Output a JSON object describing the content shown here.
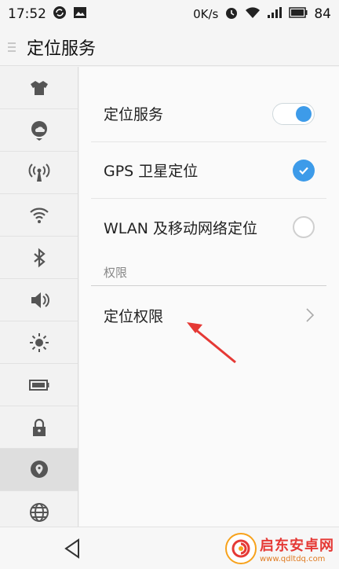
{
  "status_bar": {
    "time": "17:52",
    "speed": "0K/s",
    "battery": "84",
    "icons": [
      "sync-icon",
      "image-icon",
      "alarm-icon",
      "wifi-icon",
      "signal-icon",
      "battery-icon"
    ]
  },
  "header": {
    "title": "定位服务"
  },
  "sidebar": {
    "items": [
      {
        "icon": "theme-shirt-icon"
      },
      {
        "icon": "cloud-location-icon"
      },
      {
        "icon": "hotspot-icon"
      },
      {
        "icon": "wifi-icon"
      },
      {
        "icon": "bluetooth-icon"
      },
      {
        "icon": "sound-icon"
      },
      {
        "icon": "brightness-icon"
      },
      {
        "icon": "battery-icon"
      },
      {
        "icon": "lock-icon"
      },
      {
        "icon": "location-icon",
        "active": true
      },
      {
        "icon": "globe-icon"
      }
    ]
  },
  "settings": {
    "location_service_label": "定位服务",
    "location_service_on": true,
    "gps_label": "GPS 卫星定位",
    "gps_checked": true,
    "wlan_label": "WLAN 及移动网络定位",
    "wlan_checked": false,
    "section_permissions": "权限",
    "permissions_label": "定位权限"
  },
  "watermark": {
    "title": "启东安卓网",
    "url": "www.qdltdq.com"
  },
  "colors": {
    "accent": "#3d9be9",
    "annotation": "#e53935"
  }
}
